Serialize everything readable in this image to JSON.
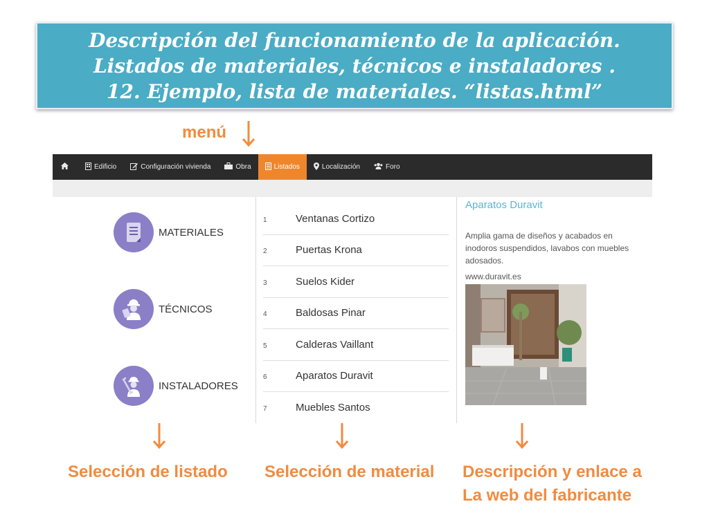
{
  "slide": {
    "title_lines": [
      "Descripción del funcionamiento de la aplicación.",
      "Listados de materiales, técnicos e instaladores .",
      "12. Ejemplo, lista de materiales. “listas.html”"
    ],
    "menu_label": "menú",
    "captions": {
      "left": "Selección de listado",
      "middle": "Selección de material",
      "right_line1": "Descripción y enlace a",
      "right_line2": "La web del fabricante"
    },
    "accent_color": "#f18b3f",
    "title_bg_color": "#4aacc5"
  },
  "navbar": {
    "items": [
      {
        "icon": "home-icon",
        "label": ""
      },
      {
        "icon": "building-icon",
        "label": "Edificio"
      },
      {
        "icon": "edit-icon",
        "label": "Configuración vivienda"
      },
      {
        "icon": "toolbox-icon",
        "label": "Obra"
      },
      {
        "icon": "list-icon",
        "label": "Listados",
        "active": true
      },
      {
        "icon": "map-marker-icon",
        "label": "Localización"
      },
      {
        "icon": "users-icon",
        "label": "Foro"
      }
    ],
    "active_color": "#f0862b"
  },
  "categories": [
    {
      "label": "MATERIALES",
      "icon": "document-icon"
    },
    {
      "label": "TÉCNICOS",
      "icon": "engineer-icon"
    },
    {
      "label": "INSTALADORES",
      "icon": "installer-icon"
    }
  ],
  "materials": [
    {
      "num": "1",
      "name": "Ventanas Cortizo"
    },
    {
      "num": "2",
      "name": "Puertas Krona"
    },
    {
      "num": "3",
      "name": "Suelos Kider"
    },
    {
      "num": "4",
      "name": "Baldosas Pinar"
    },
    {
      "num": "5",
      "name": "Calderas Vaillant"
    },
    {
      "num": "6",
      "name": "Aparatos Duravit"
    },
    {
      "num": "7",
      "name": "Muebles Santos"
    }
  ],
  "detail": {
    "title": "Aparatos Duravit",
    "description": "Amplia gama de diseños y acabados en inodoros suspendidos, lavabos con muebles adosados.",
    "link": "www.duravit.es"
  }
}
